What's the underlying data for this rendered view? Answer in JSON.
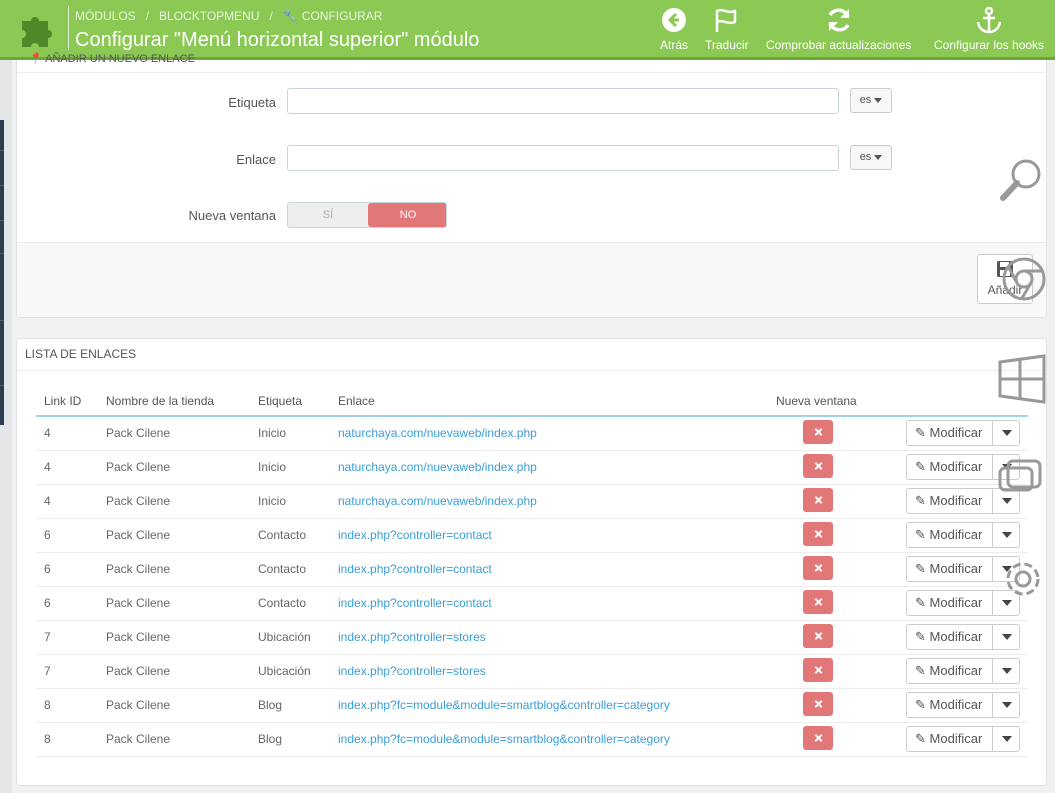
{
  "header": {
    "breadcrumb": [
      "MÓDULOS",
      "BLOCKTOPMENU",
      "CONFIGURAR"
    ],
    "breadcrumb_sep": "/",
    "title": "Configurar \"Menú horizontal superior\" módulo",
    "toolbar": [
      {
        "label": "Atrás",
        "icon": "arrow-left-circle-icon"
      },
      {
        "label": "Traducir",
        "icon": "flag-icon"
      },
      {
        "label": "Comprobar actualizaciones",
        "icon": "refresh-icon"
      },
      {
        "label": "Configurar los hooks",
        "icon": "anchor-icon"
      }
    ],
    "bg_color": "#8bc954"
  },
  "add_link_panel": {
    "heading": "AÑADIR UN NUEVO ENLACE",
    "fields": [
      {
        "label": "Etiqueta",
        "value": "",
        "lang": "es"
      },
      {
        "label": "Enlace",
        "value": "",
        "lang": "es"
      }
    ],
    "new_window": {
      "label": "Nueva ventana",
      "yes": "SÍ",
      "no": "NO",
      "selected": "NO"
    },
    "add_button": "Añadir"
  },
  "links_panel": {
    "heading": "LISTA DE ENLACES",
    "columns": [
      "Link ID",
      "Nombre de la tienda",
      "Etiqueta",
      "Enlace",
      "Nueva ventana"
    ],
    "edit_label": "Modificar",
    "rows": [
      {
        "id": "4",
        "shop": "Pack Cilene",
        "label": "Inicio",
        "link": "naturchaya.com/nuevaweb/index.php"
      },
      {
        "id": "4",
        "shop": "Pack Cilene",
        "label": "Inicio",
        "link": "naturchaya.com/nuevaweb/index.php"
      },
      {
        "id": "4",
        "shop": "Pack Cilene",
        "label": "Inicio",
        "link": "naturchaya.com/nuevaweb/index.php"
      },
      {
        "id": "6",
        "shop": "Pack Cilene",
        "label": "Contacto",
        "link": "index.php?controller=contact"
      },
      {
        "id": "6",
        "shop": "Pack Cilene",
        "label": "Contacto",
        "link": "index.php?controller=contact"
      },
      {
        "id": "6",
        "shop": "Pack Cilene",
        "label": "Contacto",
        "link": "index.php?controller=contact"
      },
      {
        "id": "7",
        "shop": "Pack Cilene",
        "label": "Ubicación",
        "link": "index.php?controller=stores"
      },
      {
        "id": "7",
        "shop": "Pack Cilene",
        "label": "Ubicación",
        "link": "index.php?controller=stores"
      },
      {
        "id": "8",
        "shop": "Pack Cilene",
        "label": "Blog",
        "link": "index.php?fc=module&module=smartblog&controller=category"
      },
      {
        "id": "8",
        "shop": "Pack Cilene",
        "label": "Blog",
        "link": "index.php?fc=module&module=smartblog&controller=category"
      }
    ]
  },
  "colors": {
    "danger": "#e27777",
    "link": "#3a9ed8",
    "header": "#8bc954"
  }
}
